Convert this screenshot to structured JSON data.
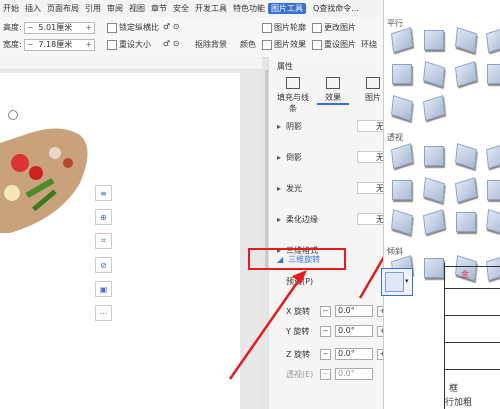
{
  "menu": [
    "开始",
    "插入",
    "页面布局",
    "引用",
    "审阅",
    "视图",
    "章节",
    "安全",
    "开发工具",
    "特色功能",
    "图片工具"
  ],
  "menu_active": "图片工具",
  "search": "Q查找命令...",
  "ribbon": {
    "height_label": "高度:",
    "height_value": "5.01厘米",
    "width_label": "宽度:",
    "width_value": "7.18厘米",
    "lock_ratio": "锁定纵横比",
    "reset_size": "重设大小",
    "remove_bg": "抠除背景",
    "color": "颜色",
    "outline": "图片轮廓",
    "effects": "图片效果",
    "change_pic": "更改图片",
    "reset_pic": "重设图片",
    "wrap": "环绕"
  },
  "panel": {
    "title": "属性",
    "tabs": [
      "填充与线条",
      "效果",
      "图片"
    ],
    "rows": [
      {
        "label": "阴影",
        "value": "无"
      },
      {
        "label": "倒影",
        "value": "无"
      },
      {
        "label": "发光",
        "value": "无"
      },
      {
        "label": "柔化边缘",
        "value": "无"
      },
      {
        "label": "三维格式",
        "value": ""
      }
    ],
    "rot3d": "三维旋转",
    "preset": "预设(P)",
    "x_rot": "X 旋转",
    "y_rot": "Y 旋转",
    "z_rot": "Z 旋转",
    "persp": "透视(E)",
    "deg": "0.0°"
  },
  "gallery": {
    "sections": [
      "平行",
      "透视",
      "倾斜"
    ]
  },
  "table": {
    "cell1": "金",
    "cell2": "框",
    "cell3": "行加粗"
  },
  "colors": {
    "accent": "#3a6fd8",
    "red": "#e31c1c"
  }
}
